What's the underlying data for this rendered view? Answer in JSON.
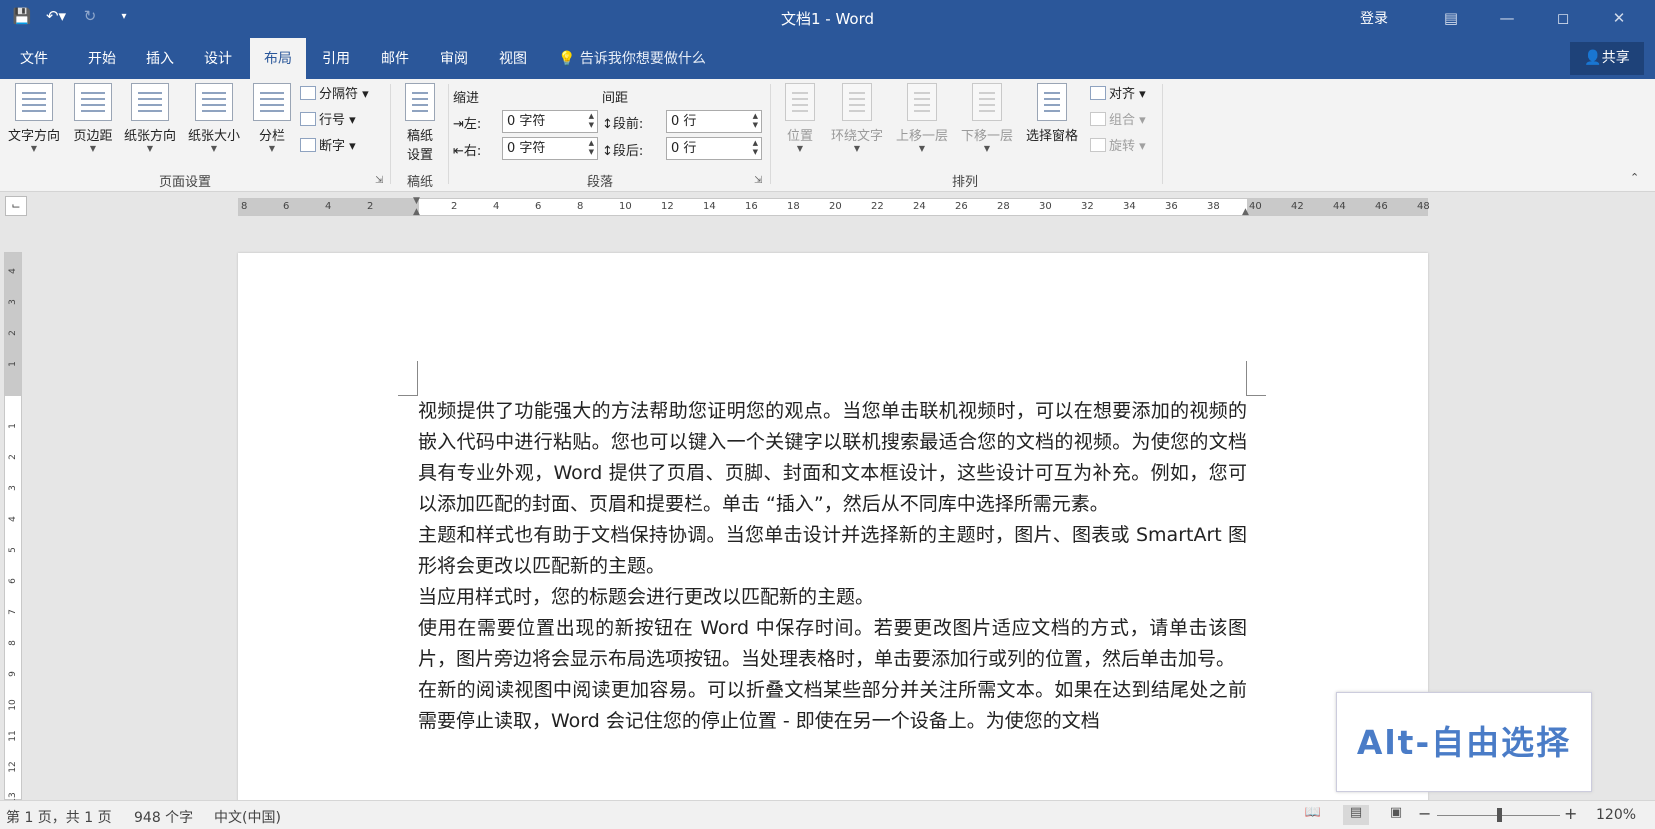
{
  "window": {
    "title": "文档1  -  Word",
    "login": "登录"
  },
  "qat": {
    "save_icon": "save-icon",
    "undo_icon": "undo-icon",
    "redo_icon": "redo-icon",
    "customize_icon": "customize-qat-icon"
  },
  "tabs": [
    {
      "label": "文件"
    },
    {
      "label": "开始"
    },
    {
      "label": "插入"
    },
    {
      "label": "设计"
    },
    {
      "label": "布局",
      "active": true
    },
    {
      "label": "引用"
    },
    {
      "label": "邮件"
    },
    {
      "label": "审阅"
    },
    {
      "label": "视图"
    }
  ],
  "tell_me": "告诉我你想要做什么",
  "share": "共享",
  "ribbon": {
    "page_setup": {
      "label": "页面设置",
      "text_direction": "文字方向",
      "margins": "页边距",
      "orientation": "纸张方向",
      "size": "纸张大小",
      "columns": "分栏",
      "breaks": "分隔符",
      "line_numbers": "行号",
      "hyphenation": "断字"
    },
    "manuscript": {
      "label": "稿纸",
      "settings_line1": "稿纸",
      "settings_line2": "设置"
    },
    "paragraph": {
      "label": "段落",
      "indent": "缩进",
      "spacing": "间距",
      "left": "左:",
      "right": "右:",
      "before": "段前:",
      "after": "段后:",
      "left_value": "0 字符",
      "right_value": "0 字符",
      "before_value": "0 行",
      "after_value": "0 行"
    },
    "arrange": {
      "label": "排列",
      "position": "位置",
      "wrap_text": "环绕文字",
      "bring_forward": "上移一层",
      "send_backward": "下移一层",
      "selection_pane": "选择窗格",
      "align": "对齐",
      "group": "组合",
      "rotate": "旋转"
    }
  },
  "ruler": {
    "h_ticks": [
      "8",
      "6",
      "4",
      "2",
      "",
      "2",
      "4",
      "6",
      "8",
      "10",
      "12",
      "14",
      "16",
      "18",
      "20",
      "22",
      "24",
      "26",
      "28",
      "30",
      "32",
      "34",
      "36",
      "38",
      "40",
      "42",
      "44",
      "46",
      "48"
    ],
    "v_ticks": [
      "4",
      "3",
      "2",
      "1",
      "",
      "1",
      "2",
      "3",
      "4",
      "5",
      "6",
      "7",
      "8",
      "9",
      "10",
      "11",
      "12",
      "13"
    ]
  },
  "document": {
    "paragraphs": [
      "视频提供了功能强大的方法帮助您证明您的观点。当您单击联机视频时，可以在想要添加的视频的嵌入代码中进行粘贴。您也可以键入一个关键字以联机搜索最适合您的文档的视频。为使您的文档具有专业外观，Word 提供了页眉、页脚、封面和文本框设计，这些设计可互为补充。例如，您可以添加匹配的封面、页眉和提要栏。单击 “插入”，然后从不同库中选择所需元素。",
      "主题和样式也有助于文档保持协调。当您单击设计并选择新的主题时，图片、图表或 SmartArt 图形将会更改以匹配新的主题。",
      "当应用样式时，您的标题会进行更改以匹配新的主题。",
      "使用在需要位置出现的新按钮在 Word 中保存时间。若要更改图片适应文档的方式，请单击该图片，图片旁边将会显示布局选项按钮。当处理表格时，单击要添加行或列的位置，然后单击加号。",
      "在新的阅读视图中阅读更加容易。可以折叠文档某些部分并关注所需文本。如果在达到结尾处之前需要停止读取，Word 会记住您的停止位置 - 即使在另一个设备上。为使您的文档"
    ]
  },
  "overlay": {
    "text": "Alt-自由选择"
  },
  "status": {
    "page": "第 1 页，共 1 页",
    "words": "948 个字",
    "language": "中文(中国)",
    "zoom_minus": "−",
    "zoom_plus": "+",
    "zoom": "120%",
    "zoom_fraction": 0.5
  }
}
